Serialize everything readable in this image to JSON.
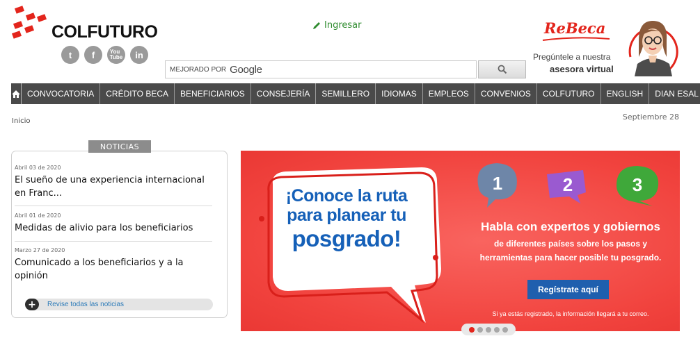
{
  "brand": {
    "name": "COLFUTURO"
  },
  "social": [
    {
      "icon": "twitter-icon",
      "glyph": "t"
    },
    {
      "icon": "facebook-icon",
      "glyph": "f"
    },
    {
      "icon": "youtube-icon",
      "glyph": "You Tube"
    },
    {
      "icon": "linkedin-icon",
      "glyph": "in"
    }
  ],
  "header": {
    "login_label": "Ingresar"
  },
  "search": {
    "prefix": "MEJORADO POR",
    "brand": "Google",
    "placeholder": ""
  },
  "rebeca": {
    "name": "ReBeca",
    "line1": "Pregúntele a nuestra",
    "line2": "asesora virtual"
  },
  "nav": {
    "items": [
      "CONVOCATORIA",
      "CRÉDITO BECA",
      "BENEFICIARIOS",
      "CONSEJERÍA",
      "SEMILLERO",
      "IDIOMAS",
      "EMPLEOS",
      "CONVENIOS",
      "COLFUTURO",
      "ENGLISH",
      "DIAN ESAL"
    ]
  },
  "breadcrumb": "Inicio",
  "date": "Septiembre 28",
  "news": {
    "tab_label": "NOTICIAS",
    "items": [
      {
        "date": "Abril 03 de 2020",
        "title": "El sueño de una experiencia internacional en Franc..."
      },
      {
        "date": "Abril 01 de 2020",
        "title": "Medidas de alivio para los beneficiarios"
      },
      {
        "date": "Marzo 27 de 2020",
        "title": "Comunicado a los beneficiarios y a la opinión"
      }
    ],
    "more_label": "Revise todas las noticias"
  },
  "banner": {
    "bubble_line1": "¡Conoce la ruta",
    "bubble_line2": "para planear tu",
    "bubble_line3": "posgrado!",
    "steps": [
      "1",
      "2",
      "3"
    ],
    "heading": "Habla con expertos y gobiernos",
    "body": "de diferentes países sobre los pasos y herramientas para hacer posible tu posgrado.",
    "button": "Regístrate aquí",
    "note": "Si ya estás registrado, la información llegará a tu correo."
  },
  "carousel": {
    "count": 5,
    "active": 1
  },
  "colors": {
    "brand_red": "#e3251c",
    "nav_bg": "#4a4a4a",
    "banner_red": "#f1433e",
    "button_blue": "#1f5fae",
    "login_green": "#2e8b2e"
  }
}
